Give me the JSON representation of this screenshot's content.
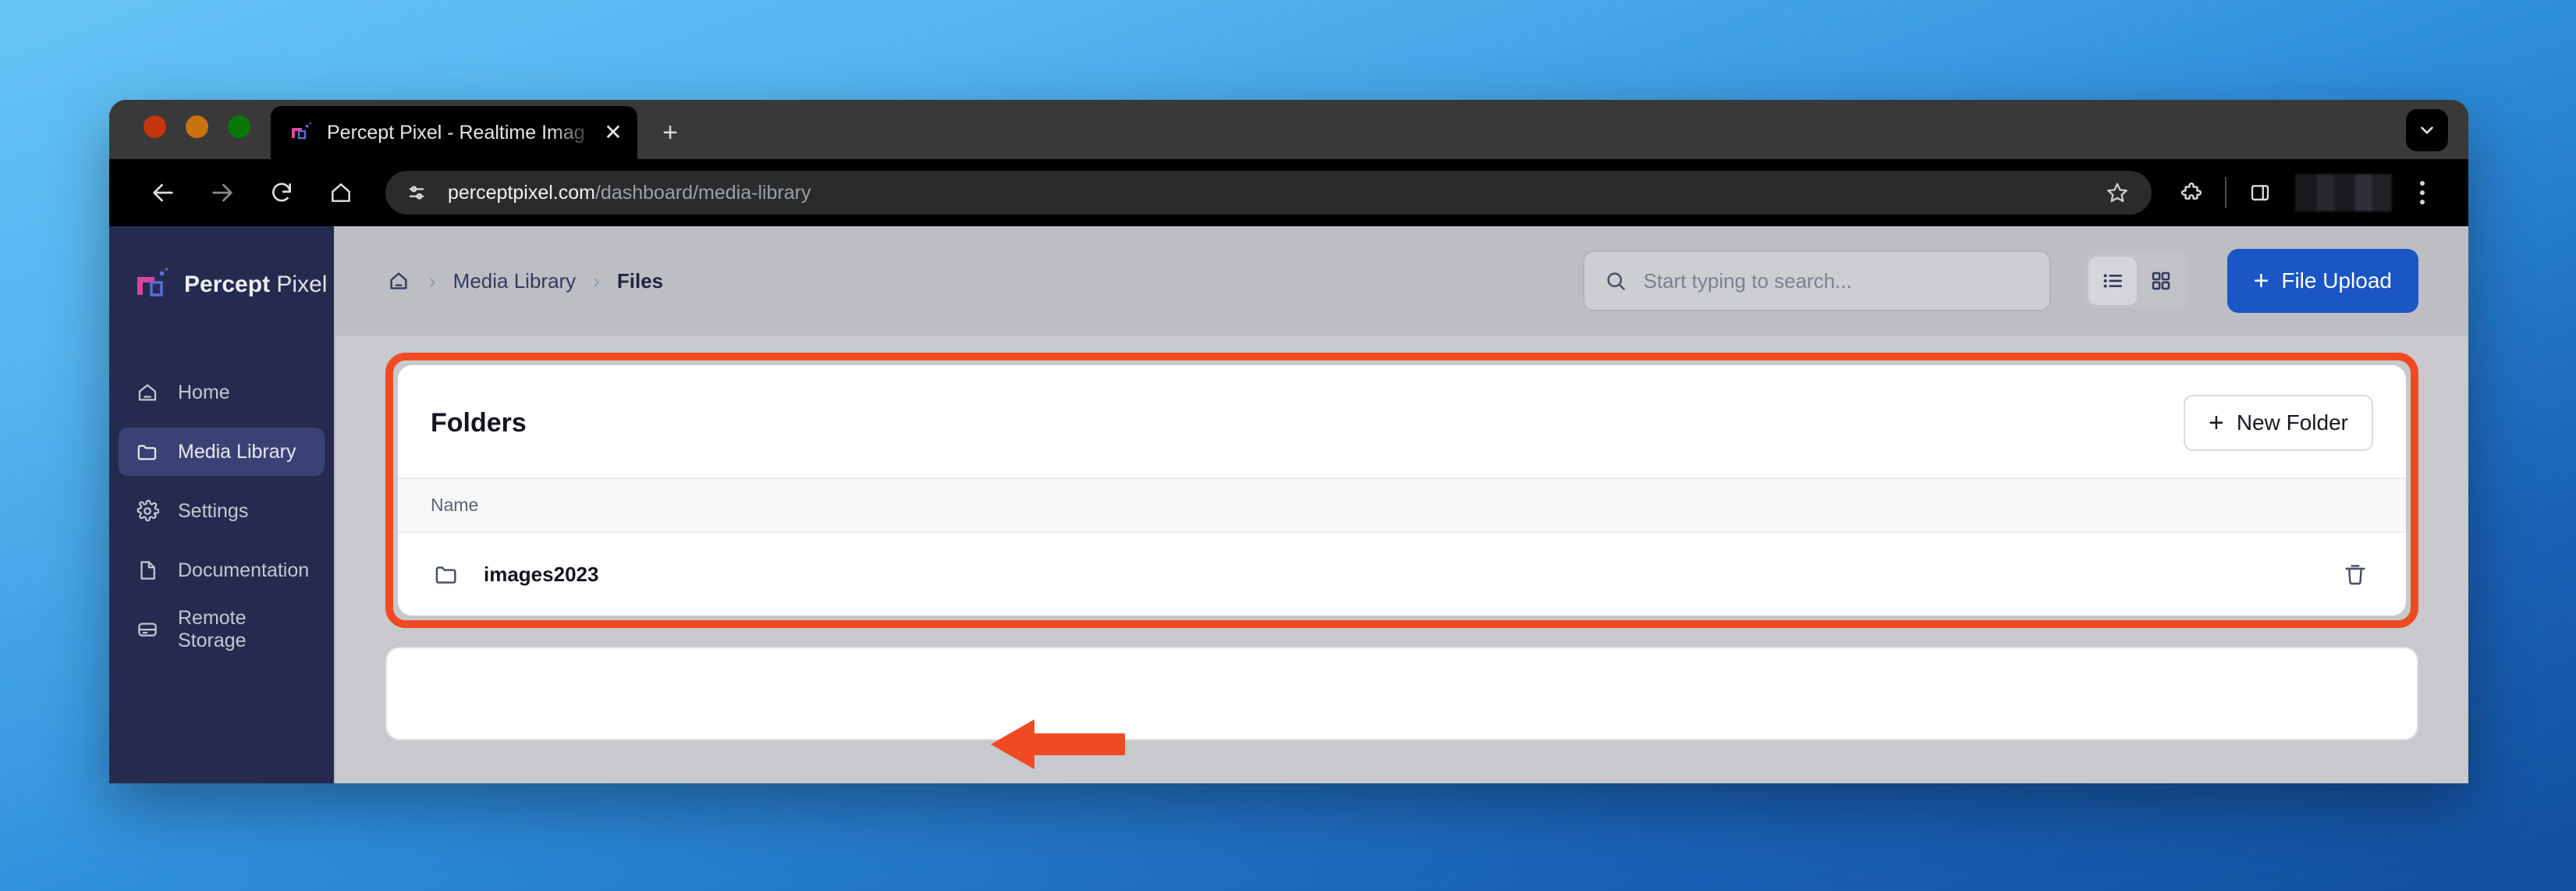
{
  "browser": {
    "tab": {
      "title": "Percept Pixel - Realtime Imag",
      "favicon_name": "percept-pixel-favicon",
      "close_label": "✕"
    },
    "new_tab_label": "+",
    "tab_list_icon": "chevron-down-icon",
    "nav": {
      "back": "back-arrow-icon",
      "forward": "forward-arrow-icon",
      "reload": "reload-icon",
      "home": "home-icon"
    },
    "omnibox": {
      "site_info_icon": "site-settings-icon",
      "url_domain": "perceptpixel.com",
      "url_path": "/dashboard/media-library",
      "bookmark_icon": "star-icon"
    },
    "toolbar_icons": {
      "extensions": "puzzle-piece-icon",
      "side_panel": "side-panel-icon",
      "profile": "profile-avatar-blurred",
      "menu": "three-dot-menu-icon"
    }
  },
  "sidebar": {
    "brand": {
      "bold_word": "Percept",
      "light_word": "Pixel"
    },
    "items": [
      {
        "label": "Home",
        "icon": "home-icon",
        "active": false
      },
      {
        "label": "Media Library",
        "icon": "folder-icon",
        "active": true
      },
      {
        "label": "Settings",
        "icon": "gear-icon",
        "active": false
      },
      {
        "label": "Documentation",
        "icon": "document-icon",
        "active": false
      },
      {
        "label": "Remote Storage",
        "icon": "server-icon",
        "active": false
      }
    ]
  },
  "header": {
    "breadcrumb": {
      "home_icon": "home-icon",
      "separator": "›",
      "link": "Media Library",
      "current": "Files"
    },
    "search": {
      "placeholder": "Start typing to search...",
      "value": "",
      "icon": "search-icon"
    },
    "view_toggle": {
      "list_label": "list-view-icon",
      "grid_label": "grid-view-icon",
      "active": "list"
    },
    "upload_button": {
      "plus": "+",
      "label": "File Upload"
    }
  },
  "folders_panel": {
    "title": "Folders",
    "new_folder_button": {
      "plus": "+",
      "label": "New Folder"
    },
    "columns": [
      "Name"
    ],
    "rows": [
      {
        "name": "images2023",
        "icon": "folder-icon",
        "delete_icon": "trash-icon"
      }
    ]
  },
  "annotations": {
    "highlight_color": "#f04a23",
    "arrow": {
      "direction": "left",
      "color": "#f04a23",
      "target": "images2023"
    }
  },
  "colors": {
    "sidebar_bg": "#252b4f",
    "sidebar_active": "#3a4275",
    "accent_blue": "#1a56c4",
    "highlight_orange": "#f04a23",
    "page_bg": "#c8c9cc",
    "header_bg": "#bcbec4"
  }
}
